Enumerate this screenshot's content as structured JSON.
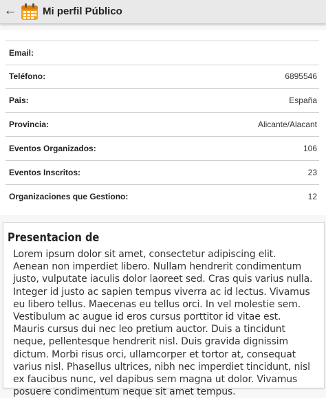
{
  "appbar": {
    "title": "Mi perfil Público",
    "back_icon": "arrow-left-icon",
    "logo_icon": "calendar-icon",
    "logo_color": "#f4a01c"
  },
  "profile": {
    "rows": [
      {
        "label": "Email:",
        "value": ""
      },
      {
        "label": "Teléfono:",
        "value": "6895546"
      },
      {
        "label": "Pais:",
        "value": "España"
      },
      {
        "label": "Provincia:",
        "value": "Alicante/Alacant"
      },
      {
        "label": "Eventos Organizados:",
        "value": "106"
      },
      {
        "label": "Eventos Inscritos:",
        "value": "23"
      },
      {
        "label": "Organizaciones que Gestiono:",
        "value": "12"
      }
    ]
  },
  "presentation": {
    "title": "Presentacion de",
    "text": "Lorem ipsum dolor sit amet, consectetur adipiscing elit. Aenean non imperdiet libero. Nullam hendrerit condimentum justo, vulputate iaculis dolor laoreet sed. Cras quis varius nulla. Integer id justo ac sapien tempus viverra ac id lectus. Vivamus eu libero tellus. Maecenas eu tellus orci. In vel molestie sem. Vestibulum ac augue id eros cursus porttitor id vitae est. Mauris cursus dui nec leo pretium auctor. Duis a tincidunt neque, pellentesque hendrerit nisl. Duis gravida dignissim dictum. Morbi risus orci, ullamcorper et tortor at, consequat varius nisl. Phasellus ultrices, nibh nec imperdiet tincidunt, nisl ex faucibus nunc, vel dapibus sem magna ut dolor. Vivamus posuere condimentum neque sit amet tempus."
  }
}
